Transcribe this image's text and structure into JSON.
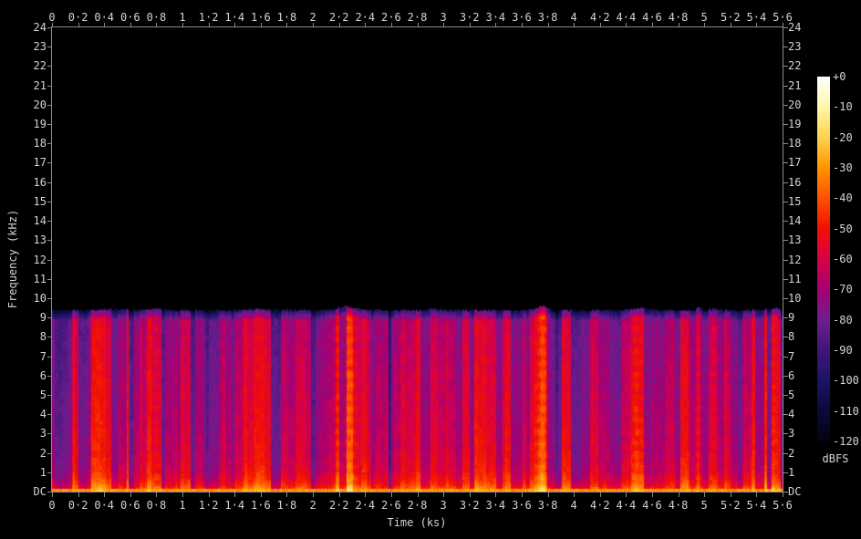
{
  "figure": {
    "background": "#000000",
    "axis_line_color": "#8c8c8c",
    "tick_label_color": "#d4d4d4"
  },
  "axes": {
    "x": {
      "title": "Time (ks)",
      "range_ks": [
        0,
        5.6
      ],
      "tick_labels": [
        "0",
        "0·2",
        "0·4",
        "0·6",
        "0·8",
        "1",
        "1·2",
        "1·4",
        "1·6",
        "1·8",
        "2",
        "2·2",
        "2·4",
        "2·6",
        "2·8",
        "3",
        "3·2",
        "3·4",
        "3·6",
        "3·8",
        "4",
        "4·2",
        "4·4",
        "4·6",
        "4·8",
        "5",
        "5·2",
        "5·4",
        "5·6"
      ]
    },
    "y": {
      "title": "Frequency (kHz)",
      "range_khz": [
        0,
        24
      ],
      "tick_labels_top_to_bottom": [
        "24",
        "23",
        "22",
        "21",
        "20",
        "19",
        "18",
        "17",
        "16",
        "15",
        "14",
        "13",
        "12",
        "11",
        "10",
        "9",
        "8",
        "7",
        "6",
        "5",
        "4",
        "3",
        "2",
        "1",
        "DC"
      ]
    }
  },
  "colorbar": {
    "unit": "dBFS",
    "range_db": [
      0,
      -120
    ],
    "tick_labels": [
      "+0",
      "-10",
      "-20",
      "-30",
      "-40",
      "-50",
      "-60",
      "-70",
      "-80",
      "-90",
      "-100",
      "-110",
      "-120"
    ]
  },
  "chart_data": {
    "type": "heatmap",
    "subtype": "audio-spectrogram",
    "title": "",
    "x_label": "Time (ks)",
    "y_label": "Frequency (kHz)",
    "z_label": "dBFS",
    "x_range_ks": [
      0,
      5.6
    ],
    "y_range_khz": [
      0,
      24
    ],
    "z_range_db": [
      0,
      -120
    ],
    "signal_cutoff_khz": 9.4,
    "background_above_cutoff": "black",
    "noise_seed": 20240,
    "colormap_stops": [
      {
        "db": 0,
        "color": "#ffffff"
      },
      {
        "db": -10,
        "color": "#fff6aa"
      },
      {
        "db": -20,
        "color": "#ffd24e"
      },
      {
        "db": -30,
        "color": "#ff9400"
      },
      {
        "db": -40,
        "color": "#ff5000"
      },
      {
        "db": -50,
        "color": "#f21000"
      },
      {
        "db": -60,
        "color": "#d80048"
      },
      {
        "db": -70,
        "color": "#a40073"
      },
      {
        "db": -80,
        "color": "#6c1e8f"
      },
      {
        "db": -90,
        "color": "#3e1678"
      },
      {
        "db": -100,
        "color": "#1c1464"
      },
      {
        "db": -110,
        "color": "#0a0a38"
      },
      {
        "db": -120,
        "color": "#030310"
      }
    ],
    "quiet_regions": [
      {
        "t0": 0.02,
        "t1": 0.16,
        "delta_db": -8
      },
      {
        "t0": 0.6,
        "t1": 0.7,
        "delta_db": -6
      },
      {
        "t0": 1.18,
        "t1": 1.3,
        "delta_db": -5
      },
      {
        "t0": 1.95,
        "t1": 2.05,
        "delta_db": -4
      },
      {
        "t0": 2.42,
        "t1": 2.62,
        "delta_db": -6
      },
      {
        "t0": 3.03,
        "t1": 3.1,
        "delta_db": -4
      },
      {
        "t0": 3.8,
        "t1": 3.88,
        "delta_db": -7
      },
      {
        "t0": 4.28,
        "t1": 4.44,
        "delta_db": -6
      },
      {
        "t0": 4.6,
        "t1": 4.7,
        "delta_db": -4
      },
      {
        "t0": 5.18,
        "t1": 5.3,
        "delta_db": -5
      }
    ],
    "loud_bands": [
      {
        "t": 0.45,
        "w": 0.2,
        "boost_db": 4
      },
      {
        "t": 0.8,
        "w": 0.06,
        "boost_db": 6
      },
      {
        "t": 1.55,
        "w": 0.12,
        "boost_db": 4
      },
      {
        "t": 2.26,
        "w": 0.1,
        "boost_db": 15
      },
      {
        "t": 2.9,
        "w": 0.08,
        "boost_db": 5
      },
      {
        "t": 3.76,
        "w": 0.05,
        "boost_db": 21
      },
      {
        "t": 4.52,
        "w": 0.1,
        "boost_db": 8
      },
      {
        "t": 4.96,
        "w": 0.022,
        "boost_db": 17
      },
      {
        "t": 5.07,
        "w": 0.04,
        "boost_db": 6
      },
      {
        "t": 5.53,
        "w": 0.05,
        "boost_db": 8
      }
    ]
  }
}
